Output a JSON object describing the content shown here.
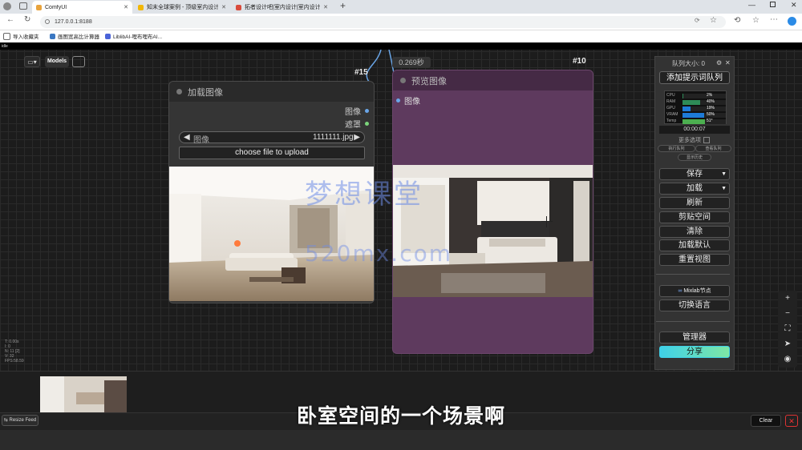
{
  "browser": {
    "tabs": [
      {
        "title": "ComfyUI",
        "active": true,
        "color": "#e8a33d"
      },
      {
        "title": "知末全球案例 - 顶级室内设计案例",
        "active": false,
        "color": "#f2b705"
      },
      {
        "title": "拓者设计吧|室内设计|室内设计师",
        "active": false,
        "color": "#d94b3c"
      }
    ],
    "url": "127.0.0.1:8188",
    "bookmarks": [
      "导入收藏夹",
      "画图宽高比计算器",
      "LiblibAI-哩布哩布AI..."
    ]
  },
  "app": {
    "strip_text": "idle",
    "models_label": "Models",
    "timing": "0.269秒",
    "load_node": {
      "id": "#15",
      "title": "加载图像",
      "outputs": [
        "图像",
        "遮罩"
      ],
      "image_label": "图像",
      "image_value": "1111111.jpg",
      "upload_label": "choose file to upload"
    },
    "preview_node": {
      "id": "#10",
      "title": "预览图像",
      "input": "图像"
    },
    "panel": {
      "queue_size": "队列大小: 0",
      "add_queue": "添加提示词队列",
      "stats": [
        {
          "label": "CPU",
          "value": "2%",
          "level": 0.02,
          "color": "#2e8b57"
        },
        {
          "label": "RAM",
          "value": "40%",
          "level": 0.4,
          "color": "#2e8b57"
        },
        {
          "label": "GPU",
          "value": "19%",
          "level": 0.19,
          "color": "#1e7bd8"
        },
        {
          "label": "VRAM",
          "value": "50%",
          "level": 0.5,
          "color": "#1e7bd8"
        },
        {
          "label": "Temp",
          "value": "51°",
          "level": 0.51,
          "color": "#4caf50"
        }
      ],
      "timer": "00:00:07",
      "more_options": "更多选项",
      "small_buttons": [
        "执行队列",
        "查看队列",
        "显示历史"
      ],
      "save": "保存",
      "load": "加载",
      "refresh": "刷新",
      "clipspace": "剪贴空间",
      "clear": "清除",
      "load_default": "加载默认",
      "reset_view": "重置视图",
      "mixlab": "Mixlab节点",
      "switch_lang": "切换语言",
      "manager": "管理器",
      "share": "分享"
    },
    "bottom": {
      "resize_feed": "Resize Feed",
      "clear": "Clear"
    },
    "stats_overlay": [
      "T: 0.00s",
      "I: 0",
      "N: 11 [2]",
      "V: 32",
      "FPS:58.59"
    ]
  },
  "overlay": {
    "watermark_cn": "梦想课堂",
    "watermark_url": "520mx.com",
    "subtitle": "卧室空间的一个场景啊"
  }
}
